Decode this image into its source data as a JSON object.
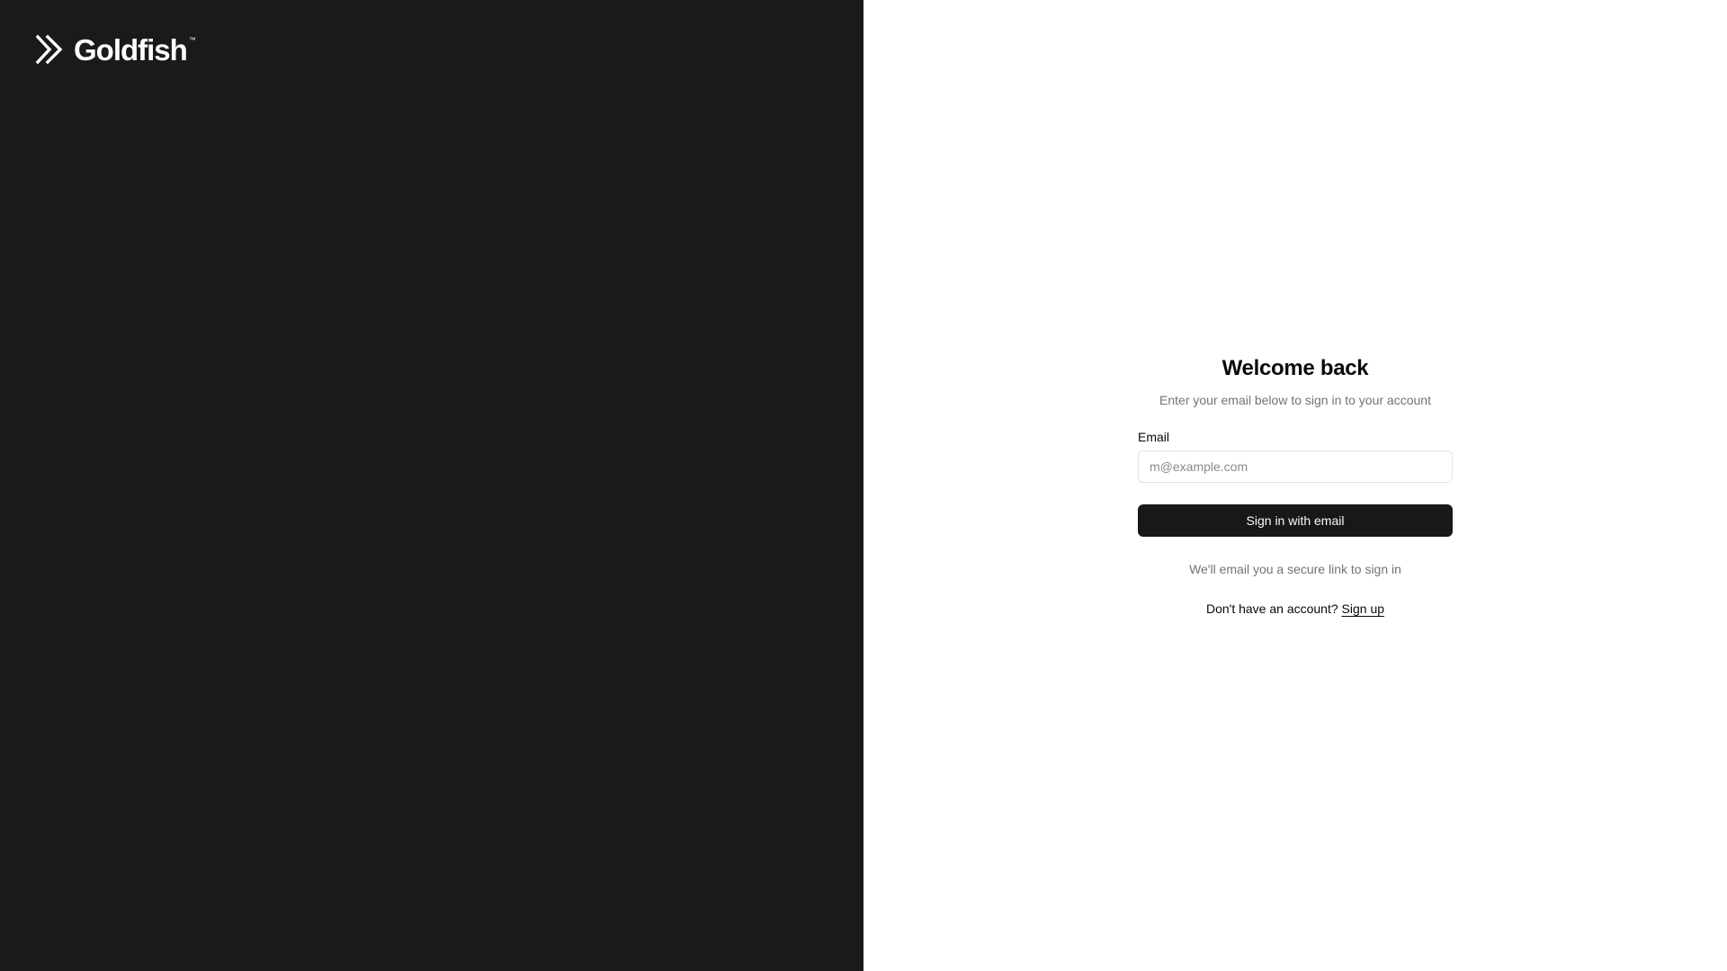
{
  "brand": {
    "name": "Goldfish",
    "trademark": "™",
    "icon": "goldfish-logo-icon",
    "left_panel_color": "#1a1a1c"
  },
  "form": {
    "title": "Welcome back",
    "subtitle": "Enter your email below to sign in to your account",
    "email_label": "Email",
    "email_placeholder": "m@example.com",
    "email_value": "",
    "submit_label": "Sign in with email",
    "hint": "We'll email you a secure link to sign in",
    "signup_prompt": "Don't have an account?",
    "signup_link": "Sign up",
    "button_color": "#18181b"
  }
}
